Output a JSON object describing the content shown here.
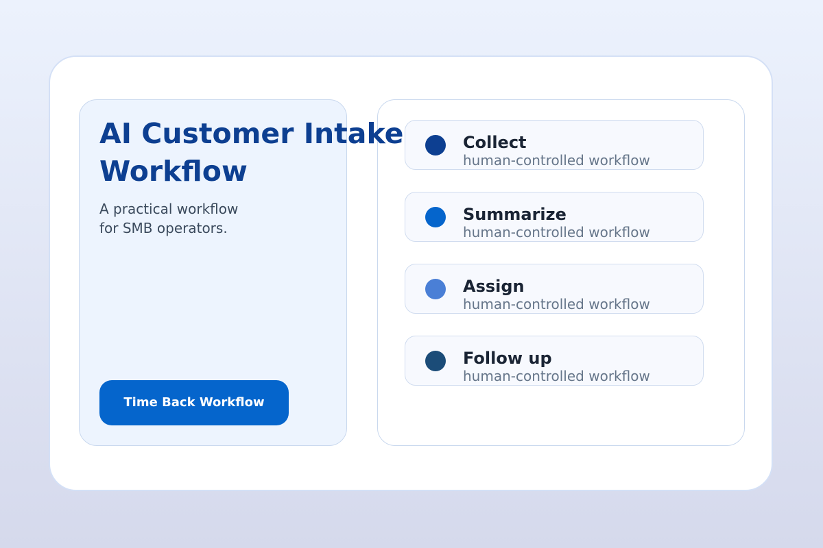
{
  "hero": {
    "title_line1": "AI Customer Intake",
    "title_line2": "Workflow",
    "subtitle_line1": "A practical workflow",
    "subtitle_line2": "for SMB operators.",
    "cta_label": "Time Back Workflow"
  },
  "steps": [
    {
      "title": "Collect",
      "subtitle": "human-controlled workflow",
      "dot_color": "#0d3f91"
    },
    {
      "title": "Summarize",
      "subtitle": "human-controlled workflow",
      "dot_color": "#0565cc"
    },
    {
      "title": "Assign",
      "subtitle": "human-controlled workflow",
      "dot_color": "#4a7fd6"
    },
    {
      "title": "Follow up",
      "subtitle": "human-controlled workflow",
      "dot_color": "#1b4c78"
    }
  ],
  "colors": {
    "accent": "#0565cc",
    "title": "#0d3f91"
  }
}
